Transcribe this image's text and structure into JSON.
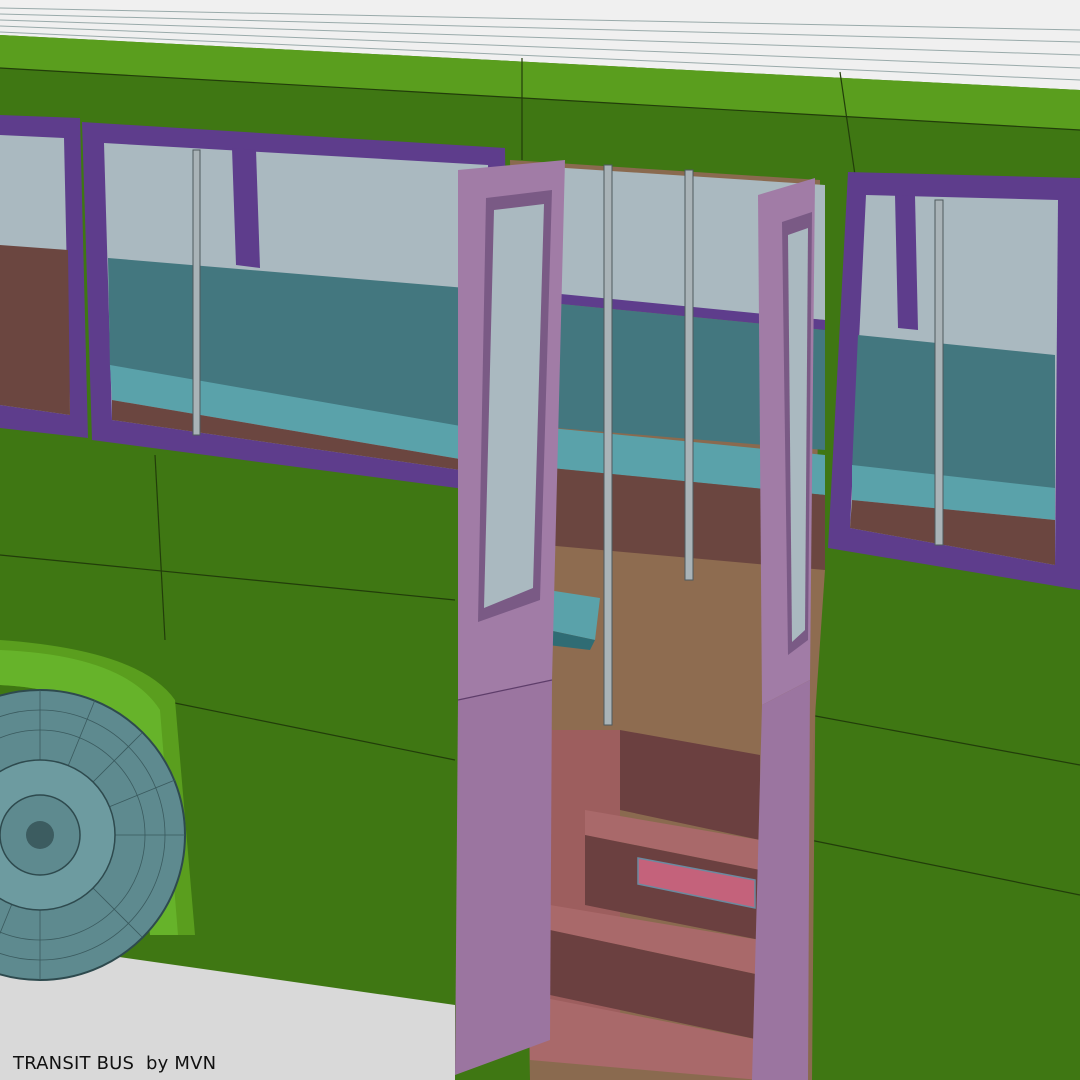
{
  "caption": {
    "title": "TRANSIT BUS",
    "by": "by",
    "author": "MVN"
  },
  "colors": {
    "body_green": "#3f7713",
    "body_green_light": "#5a9e1e",
    "roof_white": "#f2f2f2",
    "window_frame_purple": "#5e3d8c",
    "glass": "#aab9c0",
    "seat_teal": "#4d8d95",
    "door_pink": "#a17ca6",
    "interior_brown": "#8a6a4f",
    "step_red": "#9d5e5e",
    "tire_slate": "#5e8a8f",
    "ground": "#d9d9d9"
  }
}
